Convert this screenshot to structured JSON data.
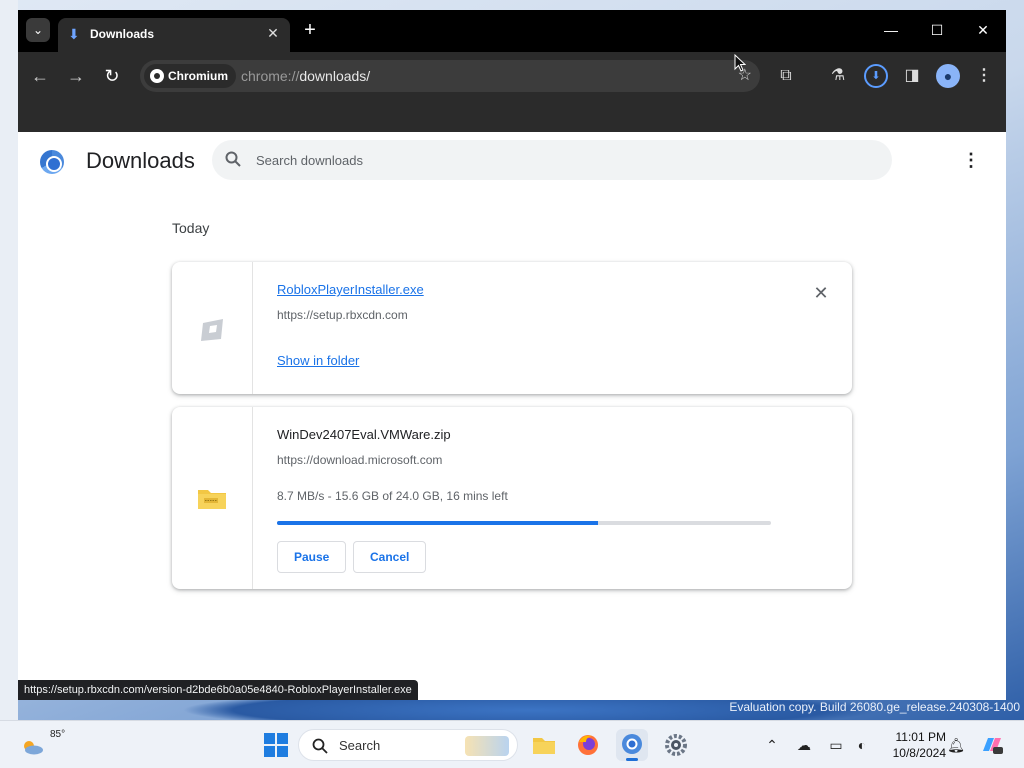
{
  "browser": {
    "tab_title": "Downloads",
    "new_tab_label": "+",
    "site_chip_label": "Chromium",
    "url_scheme": "chrome://",
    "url_path": "downloads/"
  },
  "page": {
    "title": "Downloads",
    "search_placeholder": "Search downloads",
    "section_label": "Today"
  },
  "downloads": [
    {
      "file_name": "RobloxPlayerInstaller.exe",
      "origin": "https://setup.rbxcdn.com",
      "action_label": "Show in folder",
      "state": "complete"
    },
    {
      "file_name": "WinDev2407Eval.VMWare.zip",
      "origin": "https://download.microsoft.com",
      "status": "8.7 MB/s - 15.6 GB of 24.0 GB, 16 mins left",
      "progress": 0.65,
      "pause_label": "Pause",
      "cancel_label": "Cancel",
      "state": "in_progress"
    }
  ],
  "status_bubble": "https://setup.rbxcdn.com/version-d2bde6b0a05e4840-RobloxPlayerInstaller.exe",
  "desktop": {
    "evaluation_text": "Evaluation copy. Build 26080.ge_release.240308-1400"
  },
  "taskbar": {
    "weather_temp": "85°",
    "search_label": "Search",
    "time": "11:01 PM",
    "date": "10/8/2024"
  },
  "colors": {
    "accent": "#1a73e8",
    "titlebar": "#000000",
    "toolbar": "#2b2b2b"
  }
}
